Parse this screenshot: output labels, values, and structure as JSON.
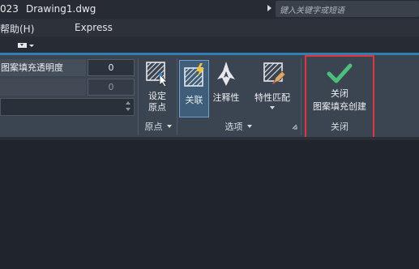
{
  "window": {
    "year_fragment": "023",
    "file_title": "Drawing1.dwg",
    "search_placeholder": "键入关键字或短语"
  },
  "menu": {
    "items": [
      "帮助(H)",
      "Express"
    ]
  },
  "ribbon": {
    "properties": {
      "transparency_label": "图案填充透明度",
      "transparency_value": "0",
      "angle_value": "0"
    },
    "origin_panel": {
      "button_label_line1": "设定",
      "button_label_line2": "原点",
      "footer": "原点"
    },
    "options_panel": {
      "associative_label": "关联",
      "annotative_label": "注释性",
      "match_properties_label": "特性匹配",
      "footer": "选项"
    },
    "close_panel": {
      "button_label_line1": "关闭",
      "button_label_line2": "图案填充创建",
      "footer": "关闭"
    }
  },
  "colors": {
    "accent_blue": "#2f7fb3",
    "check_green": "#4cc07a",
    "highlight_red": "#e5333b",
    "ribbon_bg": "#3b4451"
  }
}
